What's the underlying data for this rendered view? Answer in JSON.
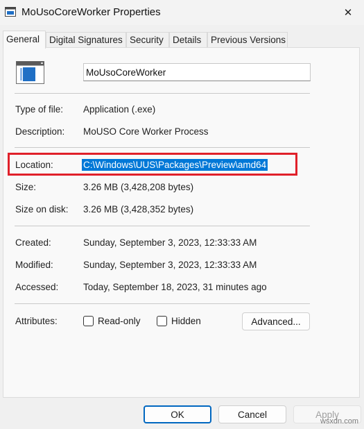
{
  "window": {
    "title": "MoUsoCoreWorker Properties",
    "close_label": "✕"
  },
  "tabs": [
    {
      "label": "General",
      "active": true
    },
    {
      "label": "Digital Signatures",
      "active": false
    },
    {
      "label": "Security",
      "active": false
    },
    {
      "label": "Details",
      "active": false
    },
    {
      "label": "Previous Versions",
      "active": false
    }
  ],
  "file": {
    "name": "MoUsoCoreWorker",
    "icon": "application-icon"
  },
  "properties": {
    "type": {
      "label": "Type of file:",
      "value": "Application (.exe)"
    },
    "description": {
      "label": "Description:",
      "value": "MoUSO Core Worker Process"
    },
    "location": {
      "label": "Location:",
      "value": "C:\\Windows\\UUS\\Packages\\Preview\\amd64"
    },
    "size": {
      "label": "Size:",
      "value": "3.26 MB (3,428,208 bytes)"
    },
    "size_on_disk": {
      "label": "Size on disk:",
      "value": "3.26 MB (3,428,352 bytes)"
    },
    "created": {
      "label": "Created:",
      "value": "Sunday, September 3, 2023, 12:33:33 AM"
    },
    "modified": {
      "label": "Modified:",
      "value": "Sunday, September 3, 2023, 12:33:33 AM"
    },
    "accessed": {
      "label": "Accessed:",
      "value": "Today, September 18, 2023, 31 minutes ago"
    }
  },
  "attributes": {
    "label": "Attributes:",
    "readonly": {
      "label": "Read-only",
      "checked": false
    },
    "hidden": {
      "label": "Hidden",
      "checked": false
    },
    "advanced_label": "Advanced..."
  },
  "footer": {
    "ok_label": "OK",
    "cancel_label": "Cancel",
    "apply_label": "Apply"
  },
  "watermark": "wsxdn.com",
  "colors": {
    "selection": "#0078d7",
    "highlight_box": "#e0202a",
    "default_button_border": "#0067c0"
  }
}
